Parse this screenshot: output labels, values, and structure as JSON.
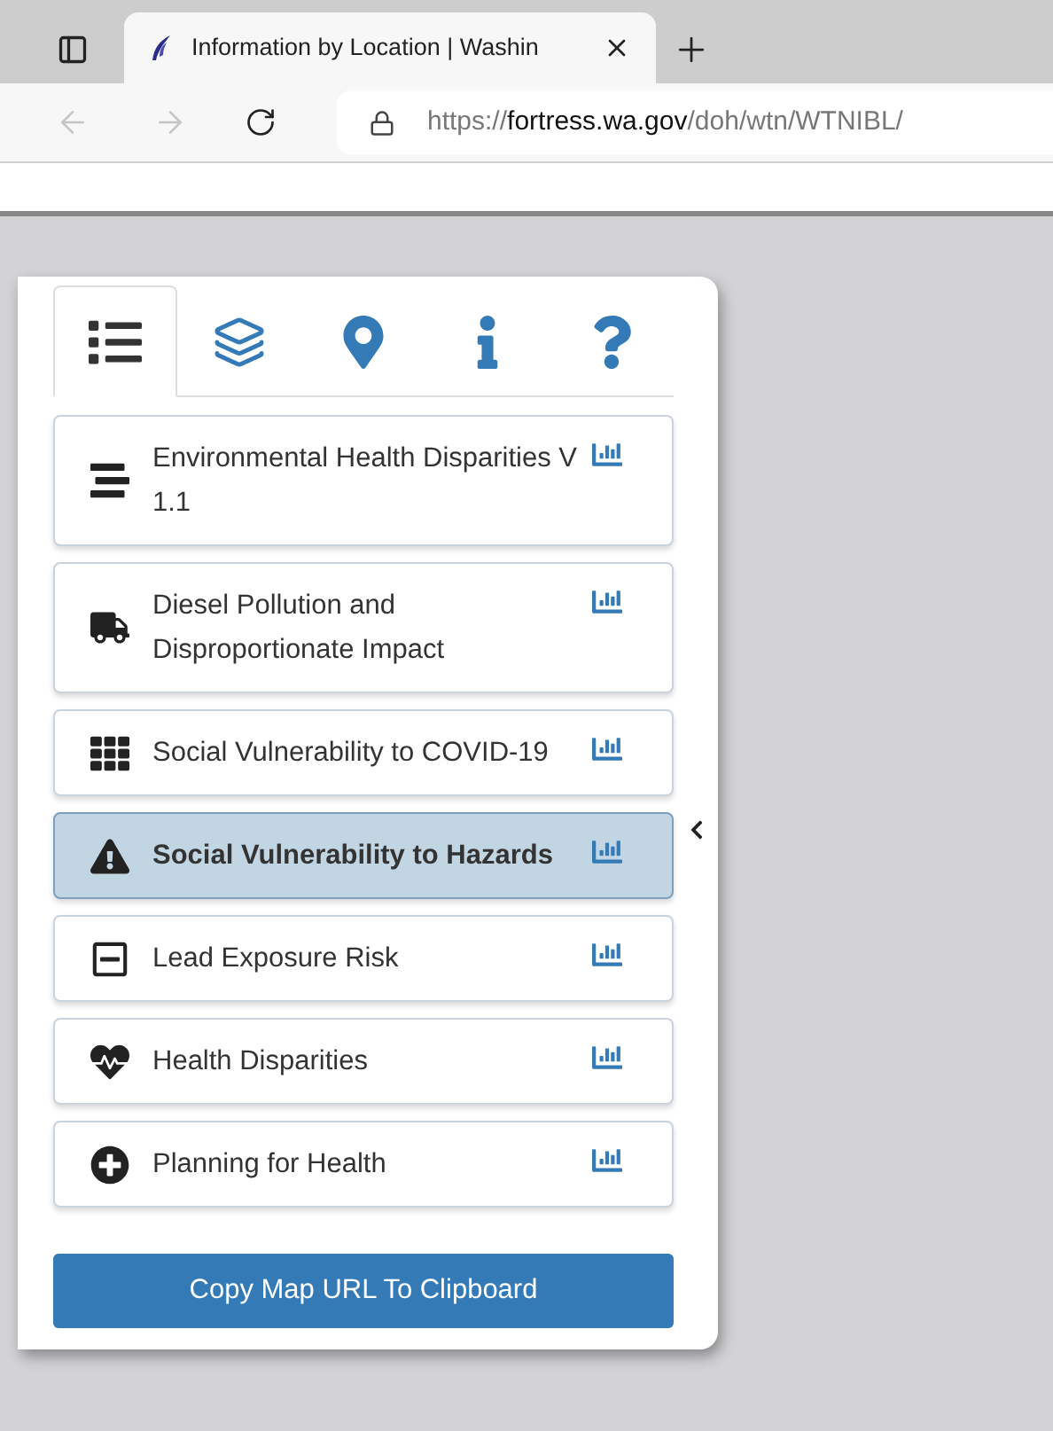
{
  "browser": {
    "tab_title": "Information by Location | Washin",
    "url": {
      "scheme": "https://",
      "host": "fortress.wa.gov",
      "path": "/doh/wtn/WTNIBL/"
    }
  },
  "panel": {
    "tabs": [
      {
        "kind": "list",
        "selected": true
      },
      {
        "kind": "layers",
        "selected": false
      },
      {
        "kind": "pin",
        "selected": false
      },
      {
        "kind": "info",
        "selected": false
      },
      {
        "kind": "help",
        "selected": false
      }
    ],
    "items": [
      {
        "kind": "lines",
        "label": "Environmental Health Disparities V 1.1",
        "selected": false
      },
      {
        "kind": "truck",
        "label": "Diesel Pollution and Disproportionate Impact",
        "selected": false
      },
      {
        "kind": "grid",
        "label": "Social Vulnerability to COVID-19",
        "selected": false
      },
      {
        "kind": "warning",
        "label": "Social Vulnerability to Hazards",
        "selected": true
      },
      {
        "kind": "minus",
        "label": "Lead Exposure Risk",
        "selected": false
      },
      {
        "kind": "heartbeat",
        "label": "Health Disparities",
        "selected": false
      },
      {
        "kind": "plus",
        "label": "Planning for Health",
        "selected": false
      }
    ],
    "button": "Copy Map URL To Clipboard"
  }
}
